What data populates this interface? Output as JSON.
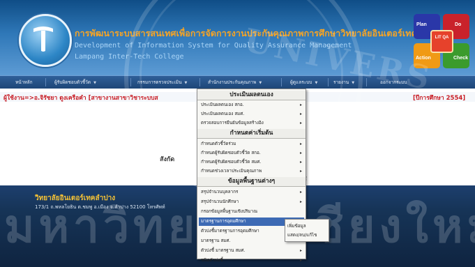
{
  "header": {
    "title_th": "การพัฒนาระบบสารสนเทศเพื่อการจัดการงานประกันคุณภาพการศึกษาวิทยาลัยอินเตอร์เทคลำปาง",
    "subtitle_en": "Development of Information System for Quality Assurance Management",
    "college_en": "Lampang Inter-Tech College",
    "pdca": {
      "plan": "Plan",
      "do": "Do",
      "action": "Action",
      "check": "Check",
      "center": "LIT QA"
    }
  },
  "menu": {
    "items": [
      {
        "label": "หน้าหลัก"
      },
      {
        "label": "ผู้รับผิดชอบตัวชี้วัด",
        "arrow": "▼"
      },
      {
        "label": "กรรมการตรวจประเมิน",
        "arrow": "▼"
      },
      {
        "label": "สำนักงานประกันคุณภาพ",
        "arrow": "▼"
      },
      {
        "label": "ผู้ดูแลระบบ",
        "arrow": "▼"
      },
      {
        "label": "รายงาน",
        "arrow": "▼"
      },
      {
        "label": "ออกจากระบบ"
      }
    ]
  },
  "status": {
    "user": "ผู้ใช้งาน=>อ.จิรัชยา ดูงเครือคำ [สาขางานสาขาวิชาระบบส",
    "year": "[ปีการศึกษา 2554]"
  },
  "main": {
    "text_left": "สังกัด",
    "text_right": "ศ"
  },
  "footer": {
    "name": "วิทยาลัยอินเตอร์เทคลำปาง",
    "address": "173/1 ถ.พหลโยธิน ต.ชมพู อ.เมือง จ.ลำปาง 52100 โทรศัพท์"
  },
  "dropdown": {
    "sections": [
      {
        "header": "ประเมินผลตนเอง",
        "items": [
          "ประเมินผลตนเอง สกอ.",
          "ประเมินผลตนเอง สมศ.",
          "ตรวจสอบการยืนยันข้อมูลสร้างอิง"
        ]
      },
      {
        "header": "กำหนดค่าเริ่มต้น",
        "items": [
          "กำหนดตัวชี้วัดร่วม",
          "กำหนดผู้รับผิดชอบตัวชี้วัด สกอ.",
          "กำหนดผู้รับผิดชอบตัวชี้วัด สมศ.",
          "กำหนดช่วงเวลาประเมินคุณภาพ"
        ]
      },
      {
        "header": "ข้อมูลพื้นฐานต่างๆ",
        "items": [
          "สรุปจำนวนบุคลากร",
          "สรุปจำนวนนักศึกษา",
          "กรอกข้อมูลพื้นฐานเชิงปริมาณ",
          "มาตรฐานการอุดมศึกษา",
          "ตัวบ่งชี้มาตรฐานการอุดมศึกษา",
          "มาตรฐาน สมศ.",
          "ตัวบ่งชี้ มาตรฐาน สมศ.",
          "ชนิดตัวบ่งชี้"
        ]
      }
    ],
    "highlighted": "มาตรฐานการอุดมศึกษา",
    "caret": "▸"
  },
  "submenu": {
    "items": [
      "เพิ่มข้อมูล",
      "แสดง/ลบ/แก้ไข"
    ]
  },
  "watermark": {
    "top_text": "UNIVERS",
    "bottom_text": "มหาวิทยาลัยเชียงใหม่"
  }
}
